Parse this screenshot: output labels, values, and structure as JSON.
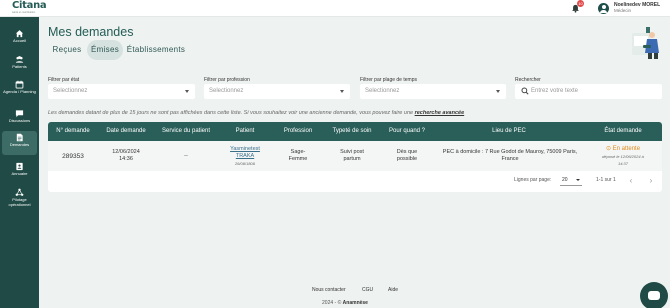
{
  "app": {
    "logo_name": "Citana",
    "logo_sub": "santé et coordination"
  },
  "topbar": {
    "notification_count": "10",
    "user_name": "Noelinedev MOREL",
    "user_role": "Médecin"
  },
  "sidebar": {
    "items": [
      {
        "label": "Accueil",
        "icon": "home-icon"
      },
      {
        "label": "Patients",
        "icon": "users-icon"
      },
      {
        "label": "Agenda / Planning",
        "icon": "calendar-icon"
      },
      {
        "label": "Discussions",
        "icon": "chat-icon"
      },
      {
        "label": "Demandes",
        "icon": "document-icon",
        "active": true
      },
      {
        "label": "Annuaire",
        "icon": "directory-icon"
      },
      {
        "label": "Pilotage opérationnel",
        "icon": "network-icon"
      }
    ]
  },
  "page": {
    "title": "Mes demandes"
  },
  "tabs": [
    {
      "label": "Reçues"
    },
    {
      "label": "Émises",
      "active": true
    },
    {
      "label": "Établissements"
    }
  ],
  "filters": {
    "state": {
      "label": "Filtrer par état",
      "placeholder": "Selectionnez"
    },
    "profession": {
      "label": "Filtrer par profession",
      "placeholder": "Selectionnez"
    },
    "time_range": {
      "label": "Filtrer par plage de temps",
      "placeholder": "Selectionnez"
    },
    "search": {
      "label": "Rechercher",
      "placeholder": "Entrez votre texte"
    }
  },
  "info": {
    "text": "Les demandes datant de plus de 15 jours ne sont pas affichées dans cette liste. Si vous souhaitez voir une ancienne demande, vous pouvez faire une ",
    "link": "recherche avancée"
  },
  "table": {
    "headers": [
      "N° demande",
      "Date demande",
      "Service du patient",
      "Patient",
      "Profession",
      "Typeté de soin",
      "Pour quand ?",
      "Lieu de PEC",
      "État demande"
    ],
    "rows": [
      {
        "number": "289353",
        "date": "12/06/2024",
        "time": "14:36",
        "service": "--",
        "patient_first": "Yasminetest",
        "patient_last": "TRAKA",
        "patient_dob": "26/08/1808",
        "profession_1": "Sage-",
        "profession_2": "Femme",
        "care_type_1": "Suivi post",
        "care_type_2": "partum",
        "when_1": "Dès que",
        "when_2": "possible",
        "place": "PEC à domicile : 7 Rue Godot de Mauroy, 75009 Paris, France",
        "status": "En attente",
        "status_sub_1": "déposé le 12/06/2024 à",
        "status_sub_2": "14:37"
      }
    ]
  },
  "pagination": {
    "per_page_label": "Lignes par page:",
    "per_page_value": "20",
    "range": "1-1 sur 1"
  },
  "footer": {
    "links": [
      "Nous contacter",
      "CGU",
      "Aide"
    ],
    "copyright": "2024 - ©",
    "brand": "Anamnèse"
  }
}
